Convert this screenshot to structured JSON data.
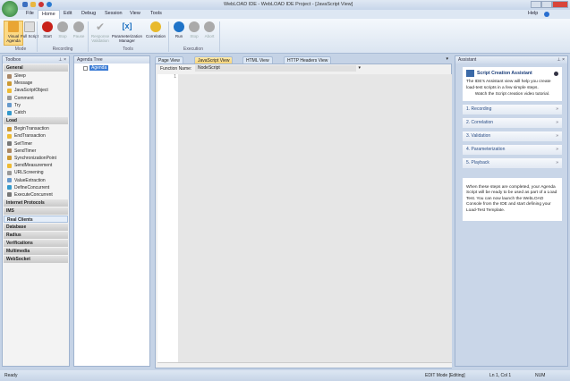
{
  "window": {
    "title": "WebLOAD IDE - WebLOAD IDE Project - [JavaScript View]",
    "logo": "IDE"
  },
  "menu": {
    "items": [
      "File",
      "Home",
      "Edit",
      "Debug",
      "Session",
      "View",
      "Tools"
    ],
    "help": "Help"
  },
  "ribbon": {
    "buttons": [
      {
        "label": "Visual Agenda",
        "state": "active"
      },
      {
        "label": "Full Script",
        "state": "normal"
      },
      {
        "label": "Start",
        "state": "normal"
      },
      {
        "label": "Stop",
        "state": "disabled"
      },
      {
        "label": "Pause",
        "state": "disabled"
      },
      {
        "label": "Response Validation",
        "state": "disabled"
      },
      {
        "label": "Parameterization Manager",
        "state": "normal"
      },
      {
        "label": "Correlation",
        "state": "normal"
      },
      {
        "label": "Run",
        "state": "normal"
      },
      {
        "label": "Stop",
        "state": "disabled"
      },
      {
        "label": "Abort",
        "state": "disabled"
      }
    ],
    "groups": [
      "Mode",
      "Recording",
      "Tools",
      "Execution"
    ]
  },
  "toolbox": {
    "title": "Toolbox",
    "general": {
      "label": "General",
      "items": [
        "Sleep",
        "Message",
        "JavaScriptObject",
        "Comment",
        "Try",
        "Catch"
      ]
    },
    "load": {
      "label": "Load",
      "items": [
        "BeginTransaction",
        "EndTransaction",
        "SetTimer",
        "SendTimer",
        "SynchronizationPoint",
        "SendMeasurement",
        "URLScreening",
        "ValueExtraction",
        "DefineConcurrent",
        "ExecuteConcurrent"
      ]
    },
    "categories": [
      "Internet Protocols",
      "IMS",
      "Real Clients",
      "Database",
      "Radius",
      "Verifications",
      "Multimedia",
      "WebSocket"
    ]
  },
  "agenda": {
    "title": "Agenda Tree",
    "root": "Agenda"
  },
  "editor": {
    "tabs": [
      "Page View",
      "JavaScript View",
      "HTML View",
      "HTTP Headers View"
    ],
    "active_tab": "JavaScript View",
    "function_label": "Function Name:",
    "function_value": "NodeScript",
    "line": "1"
  },
  "assistant": {
    "title": "Assistant",
    "heading": "Script Creation Assistant",
    "intro": "The IDE's Assistant view will help you create load-test scripts in a few simple steps.",
    "video": "Watch the Script creation video tutorial.",
    "steps": [
      "1. Recording",
      "2. Correlation",
      "3. Validation",
      "4. Parameterization",
      "5. Playback"
    ],
    "outro": "When these steps are completed, your Agenda Script will be ready to be used as part of a Load Test. You can now launch the WebLOAD Console from the IDE and start defining your Load-Test Template."
  },
  "status": {
    "left": "Ready",
    "mode": "EDIT Mode [Editing]",
    "position": "Ln 1, Col 1",
    "num": "NUM"
  }
}
